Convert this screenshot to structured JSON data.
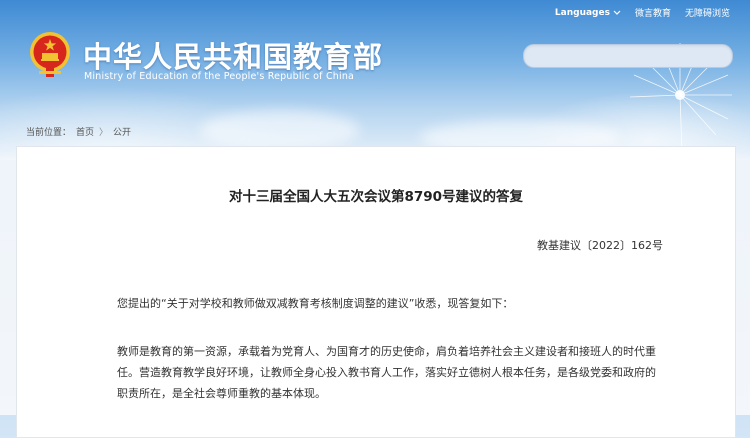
{
  "topbar": {
    "languages": "Languages",
    "weibo": "微言教育",
    "accessible": "无障碍浏览"
  },
  "logo": {
    "cn": "中华人民共和国教育部",
    "en": "Ministry of Education of the People's Republic of China"
  },
  "search": {
    "placeholder": ""
  },
  "breadcrumb": {
    "prefix": "当前位置：",
    "home": "首页",
    "separator": "〉",
    "current": "公开"
  },
  "article": {
    "title": "对十三届全国人大五次会议第8790号建议的答复",
    "doc_number": "教基建议〔2022〕162号",
    "para1": "您提出的“关于对学校和教师做双减教育考核制度调整的建议”收悉，现答复如下：",
    "para2": "教师是教育的第一资源，承载着为党育人、为国育才的历史使命，肩负着培养社会主义建设者和接班人的时代重任。营造教育教学良好环境，让教师全身心投入教书育人工作，落实好立德树人根本任务，是各级党委和政府的职责所在，是全社会尊师重教的基本体现。"
  },
  "icons": {
    "emblem": "national-emblem-icon",
    "dropdown": "chevron-down-icon",
    "decoration": "dandelion-icon"
  },
  "colors": {
    "header_blue": "#3f8ad3",
    "emblem_red": "#d7261b",
    "emblem_gold": "#f2c230"
  }
}
